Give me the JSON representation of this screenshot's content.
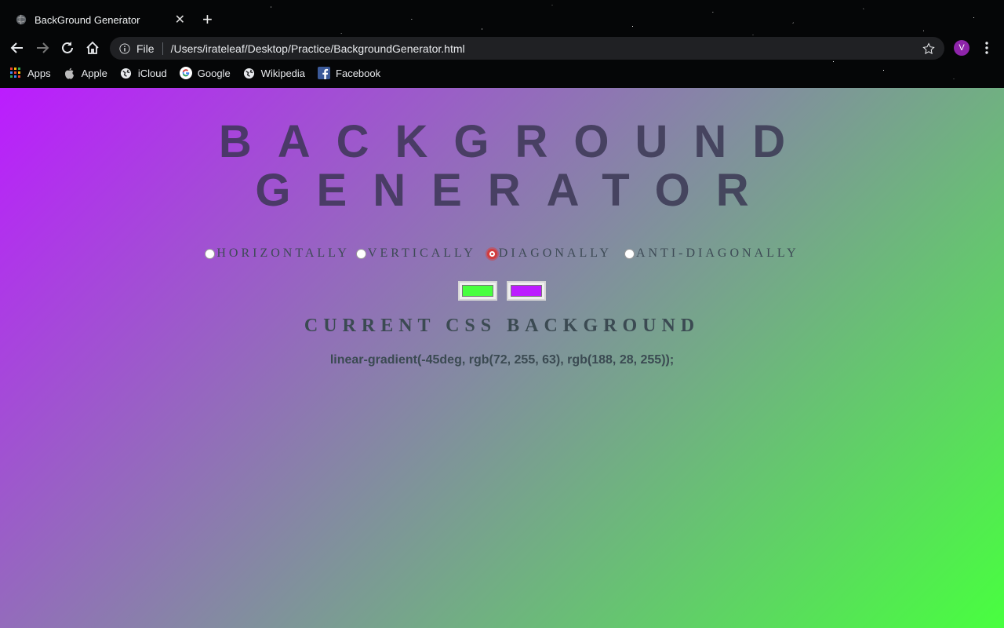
{
  "browser": {
    "tab_title": "BackGround Generator",
    "tab_close": "✕",
    "new_tab": "+",
    "scheme": "File",
    "url": "/Users/irateleaf/Desktop/Practice/BackgroundGenerator.html",
    "avatar_letter": "V"
  },
  "bookmarks": [
    {
      "label": "Apps",
      "icon": "apps-grid-icon"
    },
    {
      "label": "Apple",
      "icon": "apple-icon"
    },
    {
      "label": "iCloud",
      "icon": "globe-icon"
    },
    {
      "label": "Google",
      "icon": "google-icon"
    },
    {
      "label": "Wikipedia",
      "icon": "globe-icon"
    },
    {
      "label": "Facebook",
      "icon": "facebook-icon"
    }
  ],
  "page": {
    "title_line1": "BACKGROUND",
    "title_line2": "GENERATOR",
    "directions": [
      {
        "label": "HORIZONTALLY",
        "checked": false
      },
      {
        "label": "VERTICALLY",
        "checked": false
      },
      {
        "label": "DIAGONALLY",
        "checked": true
      },
      {
        "label": "ANTI-DIAGONALLY",
        "checked": false
      }
    ],
    "color1": "#48ff3f",
    "color2": "#bc1cff",
    "css_heading": "CURRENT CSS BACKGROUND",
    "css_value": "linear-gradient(-45deg, rgb(72, 255, 63), rgb(188, 28, 255));"
  }
}
